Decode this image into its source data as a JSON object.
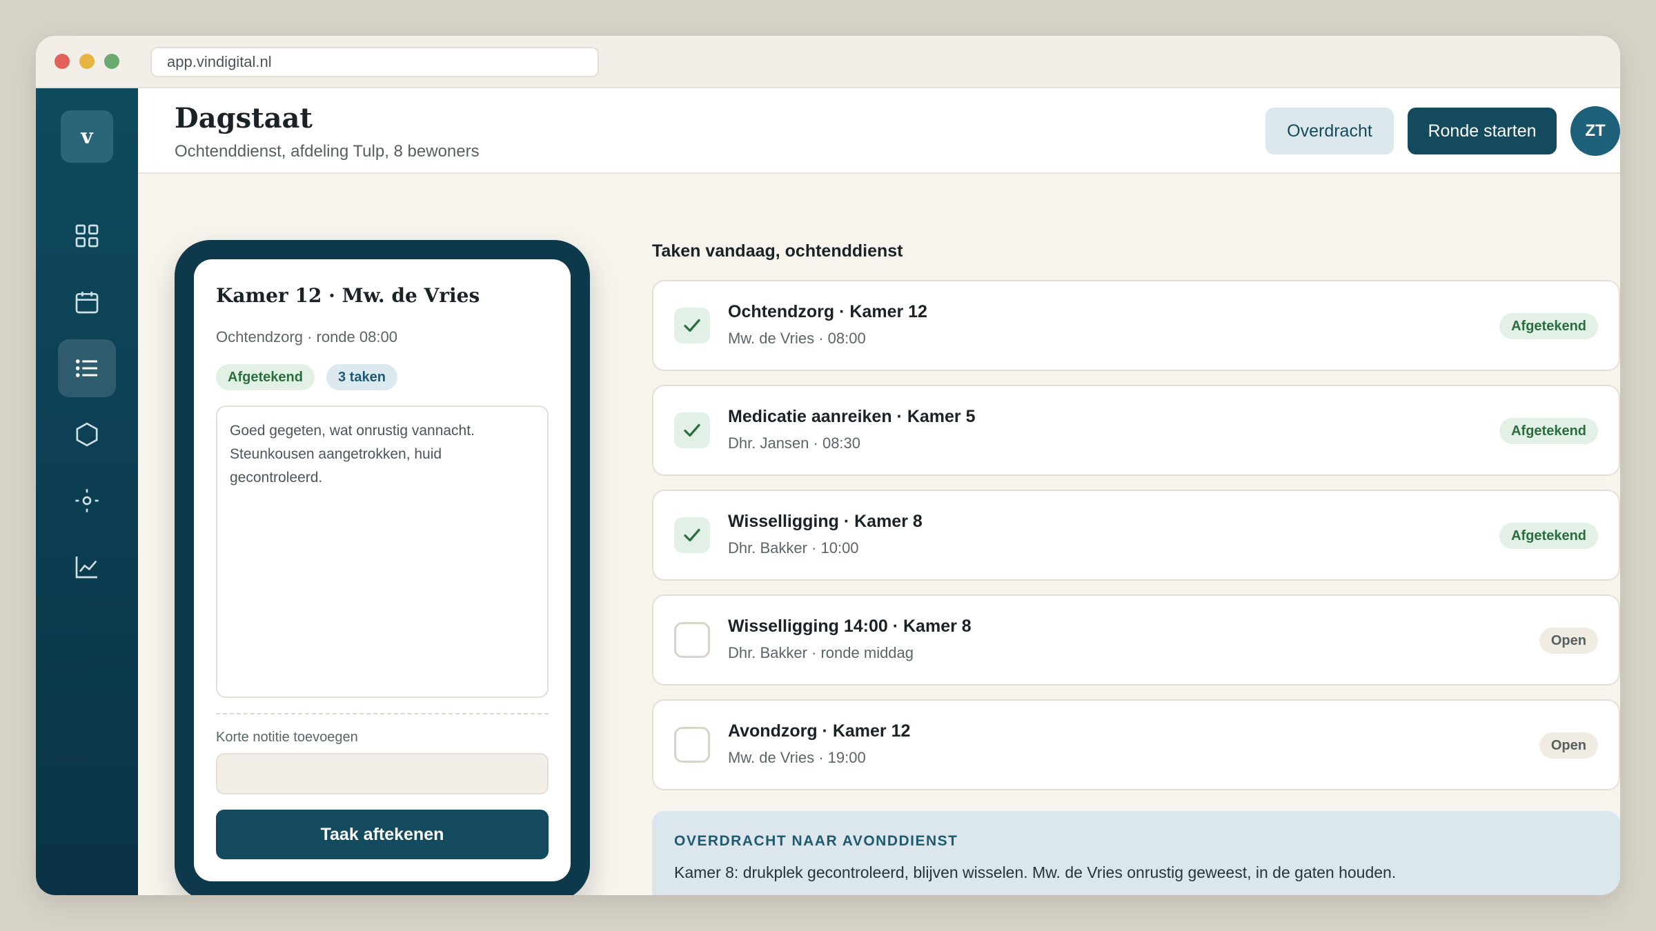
{
  "browser": {
    "url": "app.vindigital.nl"
  },
  "sidebar": {
    "logo": "v",
    "items": [
      {
        "icon": "dashboard-grid-icon"
      },
      {
        "icon": "calendar-icon"
      },
      {
        "icon": "list-icon",
        "active": true
      },
      {
        "icon": "hexagon-icon"
      },
      {
        "icon": "settings-target-icon"
      },
      {
        "icon": "line-chart-icon"
      }
    ]
  },
  "header": {
    "title": "Dagstaat",
    "subtitle": "Ochtenddienst, afdeling Tulp, 8 bewoners",
    "handover_label": "Overdracht",
    "start_round_label": "Ronde starten",
    "avatar_initials": "ZT"
  },
  "phone": {
    "title": "Kamer 12 · Mw. de Vries",
    "subtitle": "Ochtendzorg · ronde 08:00",
    "chip_status": "Afgetekend",
    "chip_count": "3 taken",
    "note_text": "Goed gegeten, wat onrustig vannacht. Steunkousen aangetrokken, huid gecontroleerd.",
    "note_label": "Korte notitie toevoegen",
    "note_placeholder": "",
    "sign_button": "Taak aftekenen"
  },
  "tasks": {
    "section_title": "Taken vandaag, ochtenddienst",
    "items": [
      {
        "title": "Ochtendzorg · Kamer 12",
        "meta": "Mw. de Vries · 08:00",
        "status": "Afgetekend",
        "done": true
      },
      {
        "title": "Medicatie aanreiken · Kamer 5",
        "meta": "Dhr. Jansen · 08:30",
        "status": "Afgetekend",
        "done": true
      },
      {
        "title": "Wisselligging · Kamer 8",
        "meta": "Dhr. Bakker · 10:00",
        "status": "Afgetekend",
        "done": true
      },
      {
        "title": "Wisselligging 14:00 · Kamer 8",
        "meta": "Dhr. Bakker · ronde middag",
        "status": "Open",
        "done": false
      },
      {
        "title": "Avondzorg · Kamer 12",
        "meta": "Mw. de Vries · 19:00",
        "status": "Open",
        "done": false
      }
    ]
  },
  "handover": {
    "title": "OVERDRACHT NAAR AVONDDIENST",
    "text": "Kamer 8: drukplek gecontroleerd, blijven wisselen. Mw. de Vries onrustig geweest, in de gaten houden."
  },
  "colors": {
    "brand": "#134a5e",
    "signed_bg": "#e2f0e6",
    "signed_text": "#2b6e3e",
    "handover_bg": "#dbe7ec"
  }
}
